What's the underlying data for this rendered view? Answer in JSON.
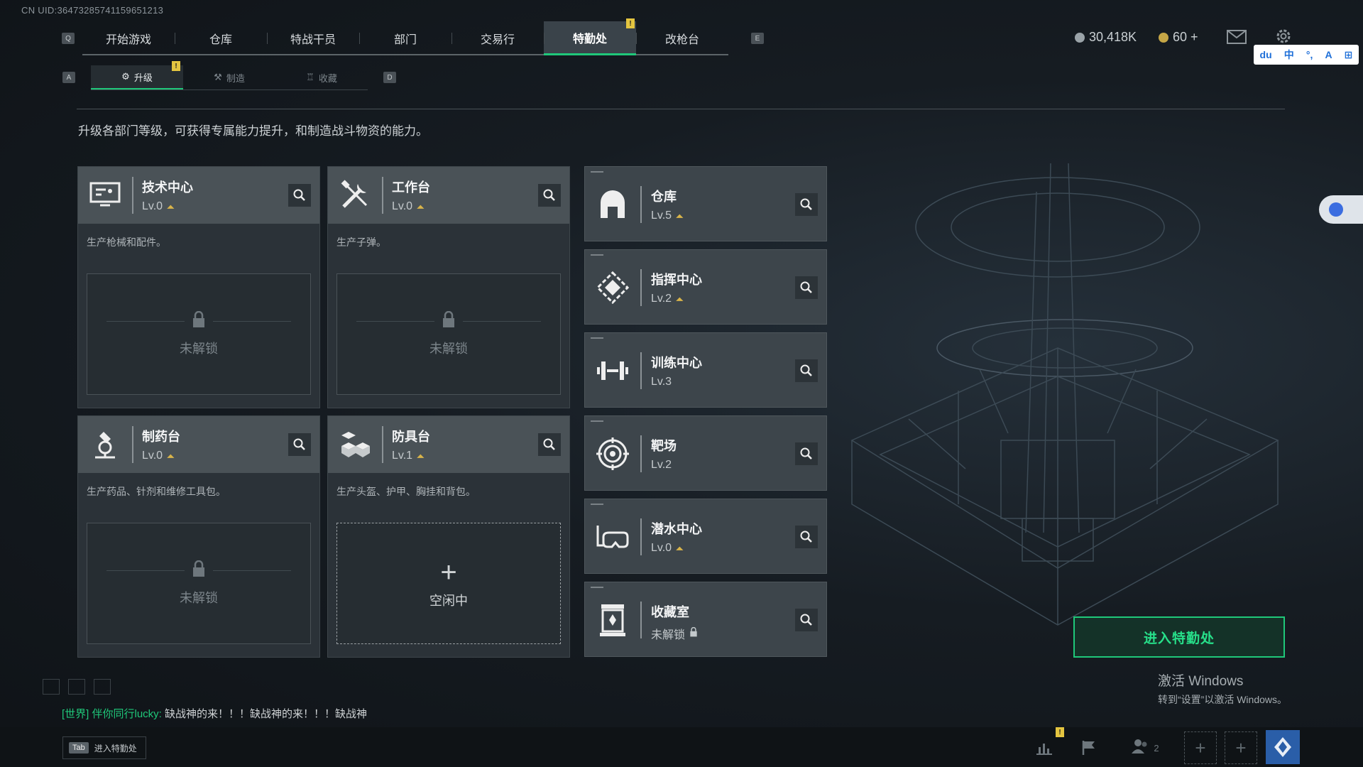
{
  "uid": "CN UID:36473285741159651213",
  "keys": {
    "q": "Q",
    "e": "E",
    "a": "A",
    "d": "D"
  },
  "top_nav": [
    {
      "label": "开始游戏"
    },
    {
      "label": "仓库"
    },
    {
      "label": "特战干员"
    },
    {
      "label": "部门"
    },
    {
      "label": "交易行"
    },
    {
      "label": "特勤处",
      "active": true,
      "badge": "!"
    },
    {
      "label": "改枪台"
    }
  ],
  "sub_nav": [
    {
      "label": "升级",
      "active": true,
      "badge": "!"
    },
    {
      "label": "制造"
    },
    {
      "label": "收藏"
    }
  ],
  "currency": {
    "coin_value": "30,418K",
    "token_value": "60 +"
  },
  "ime": {
    "items": [
      "du",
      "中",
      "°,",
      "A",
      "⊞"
    ]
  },
  "description": "升级各部门等级，可获得专属能力提升，和制造战斗物资的能力。",
  "big_cards": [
    {
      "name": "技术中心",
      "level": "Lv.0",
      "desc": "生产枪械和配件。",
      "slot": "未解锁",
      "icon": "monitor-icon"
    },
    {
      "name": "工作台",
      "level": "Lv.0",
      "desc": "生产子弹。",
      "slot": "未解锁",
      "icon": "tools-icon"
    },
    {
      "name": "制药台",
      "level": "Lv.0",
      "desc": "生产药品、针剂和维修工具包。",
      "slot": "未解锁",
      "icon": "microscope-icon"
    },
    {
      "name": "防具台",
      "level": "Lv.1",
      "desc": "生产头盔、护甲、胸挂和背包。",
      "slot": "空闲中",
      "icon": "armor-icon"
    }
  ],
  "small_cards": [
    {
      "name": "仓库",
      "level": "Lv.5",
      "icon": "warehouse-icon"
    },
    {
      "name": "指挥中心",
      "level": "Lv.2",
      "icon": "command-icon"
    },
    {
      "name": "训练中心",
      "level": "Lv.3",
      "icon": "dumbbell-icon"
    },
    {
      "name": "靶场",
      "level": "Lv.2",
      "icon": "target-icon"
    },
    {
      "name": "潜水中心",
      "level": "Lv.0",
      "icon": "goggles-icon"
    },
    {
      "name": "收藏室",
      "level": "未解锁",
      "icon": "collection-icon"
    }
  ],
  "enter_button": "进入特勤处",
  "windows_activation": {
    "title": "激活 Windows",
    "sub": "转到“设置”以激活 Windows。"
  },
  "chat": {
    "channel": "[世界] 伴你同行lucky:",
    "message": "缺战神的来！！！缺战神的来！！！缺战神"
  },
  "tab_hint": {
    "key": "Tab",
    "label": "进入特勤处"
  },
  "bottom": {
    "friends_count": "2"
  },
  "colors": {
    "accent": "#1fc87a",
    "badge": "#e4c540",
    "upgrade": "#d9b44a"
  }
}
